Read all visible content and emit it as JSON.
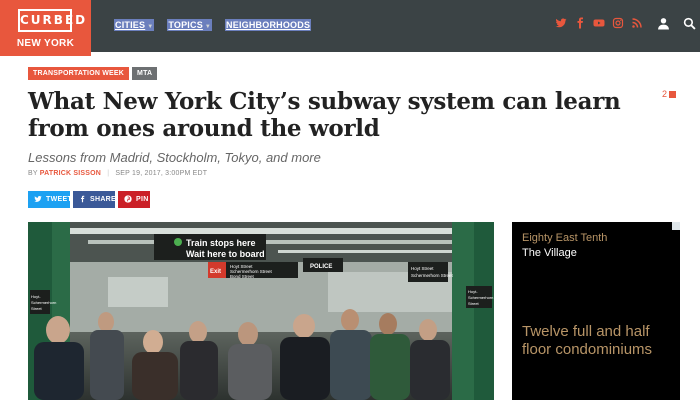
{
  "header": {
    "logo_word": "CURBED",
    "logo_city": "NEW YORK",
    "nav": [
      {
        "label": "CITIES"
      },
      {
        "label": "TOPICS"
      },
      {
        "label": "NEIGHBORHOODS"
      }
    ],
    "social_icons": [
      "twitter-icon",
      "facebook-icon",
      "youtube-icon",
      "instagram-icon",
      "rss-icon"
    ],
    "accent_color": "#e8573d",
    "bar_color": "#3b4345"
  },
  "article": {
    "tags": [
      "TRANSPORTATION WEEK",
      "MTA"
    ],
    "title": "What New York City’s subway system can learn from ones around the world",
    "comment_count": "2",
    "subtitle": "Lessons from Madrid, Stockholm, Tokyo, and more",
    "by_prefix": "BY",
    "author": "PATRICK SISSON",
    "date": "SEP 19, 2017, 3:00PM EDT",
    "share": {
      "tweet": "TWEET",
      "share": "SHARE",
      "pin": "PIN"
    },
    "photo": {
      "sign_line1": "Train stops here",
      "sign_line2": "Wait here to board",
      "exit_label": "Exit",
      "exit_sub1": "Hoyt Street",
      "exit_sub2": "Schermerhorn Street",
      "exit_sub3": "Bond Street",
      "police_label": "POLICE",
      "right_sign1": "Hoyt Street",
      "right_sign2": "Schermerhorn Street",
      "pillar_left1": "Hoyt-",
      "pillar_left2": "Schermerhorn",
      "pillar_left3": "Street",
      "pillar_right1": "Hoyt-",
      "pillar_right2": "Schermerhorn",
      "pillar_right3": "Street"
    }
  },
  "ad": {
    "line1": "Eighty East Tenth",
    "line2": "The Village",
    "line3": "Twelve full and half floor condominiums"
  }
}
